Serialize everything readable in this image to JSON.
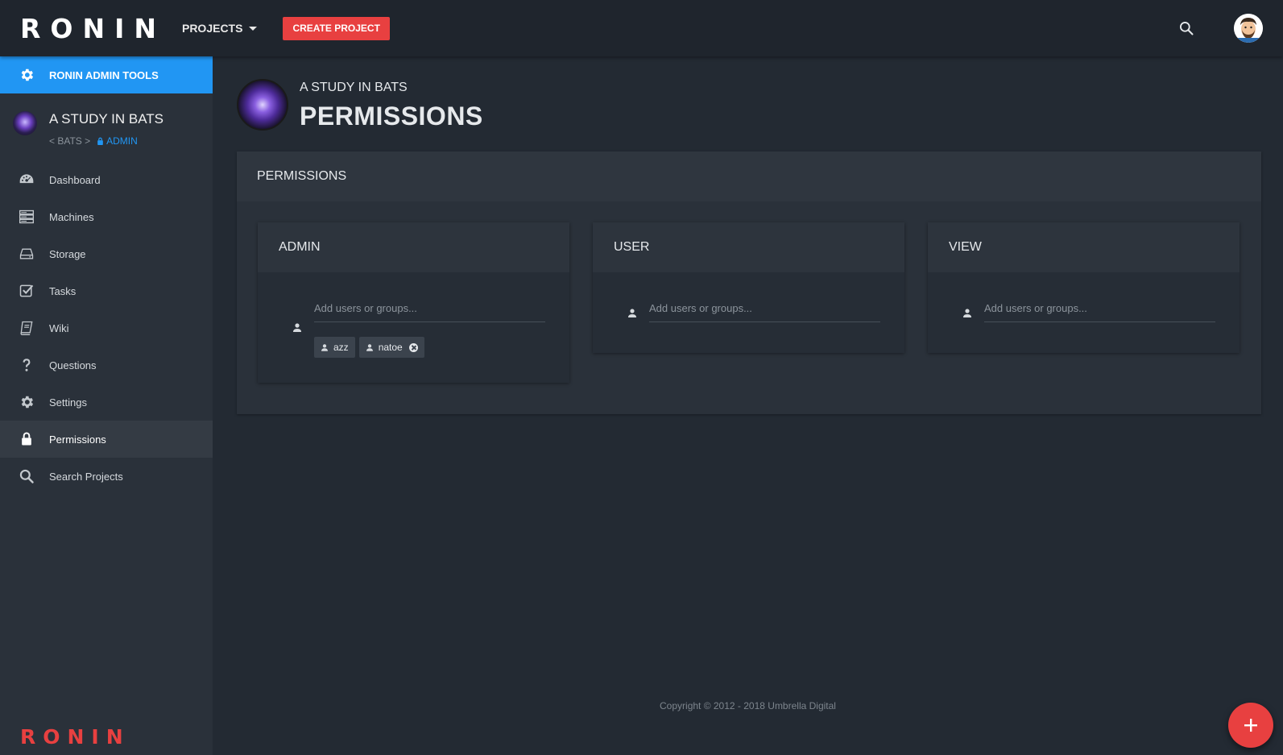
{
  "topbar": {
    "logo": "RONIN",
    "projects_label": "PROJECTS",
    "create_label": "CREATE PROJECT",
    "icons": {
      "search": "search-icon",
      "avatar": "user-avatar"
    }
  },
  "sidebar": {
    "admin_tools_label": "RONIN ADMIN TOOLS",
    "project_name": "A STUDY IN BATS",
    "crumb_back": "< BATS >",
    "crumb_admin": "ADMIN",
    "items": [
      {
        "label": "Dashboard",
        "icon": "dashboard-icon"
      },
      {
        "label": "Machines",
        "icon": "server-icon"
      },
      {
        "label": "Storage",
        "icon": "hard-drive-icon"
      },
      {
        "label": "Tasks",
        "icon": "check-square-icon"
      },
      {
        "label": "Wiki",
        "icon": "book-icon"
      },
      {
        "label": "Questions",
        "icon": "question-icon"
      },
      {
        "label": "Settings",
        "icon": "gear-icon"
      },
      {
        "label": "Permissions",
        "icon": "lock-icon"
      },
      {
        "label": "Search Projects",
        "icon": "search-icon"
      }
    ],
    "footer_logo": "RONIN"
  },
  "header": {
    "subtitle": "A STUDY IN BATS",
    "title": "PERMISSIONS"
  },
  "panel": {
    "title": "PERMISSIONS",
    "groups": [
      {
        "title": "ADMIN",
        "placeholder": "Add users or groups...",
        "members": [
          "azz",
          "natoe"
        ]
      },
      {
        "title": "USER",
        "placeholder": "Add users or groups...",
        "members": []
      },
      {
        "title": "VIEW",
        "placeholder": "Add users or groups...",
        "members": []
      }
    ]
  },
  "footer": {
    "copyright": "Copyright © 2012 - 2018 Umbrella Digital"
  },
  "colors": {
    "accent": "#2196f3",
    "brand_red": "#e84040",
    "background": "#232a33",
    "sidebar": "#2a313a"
  }
}
